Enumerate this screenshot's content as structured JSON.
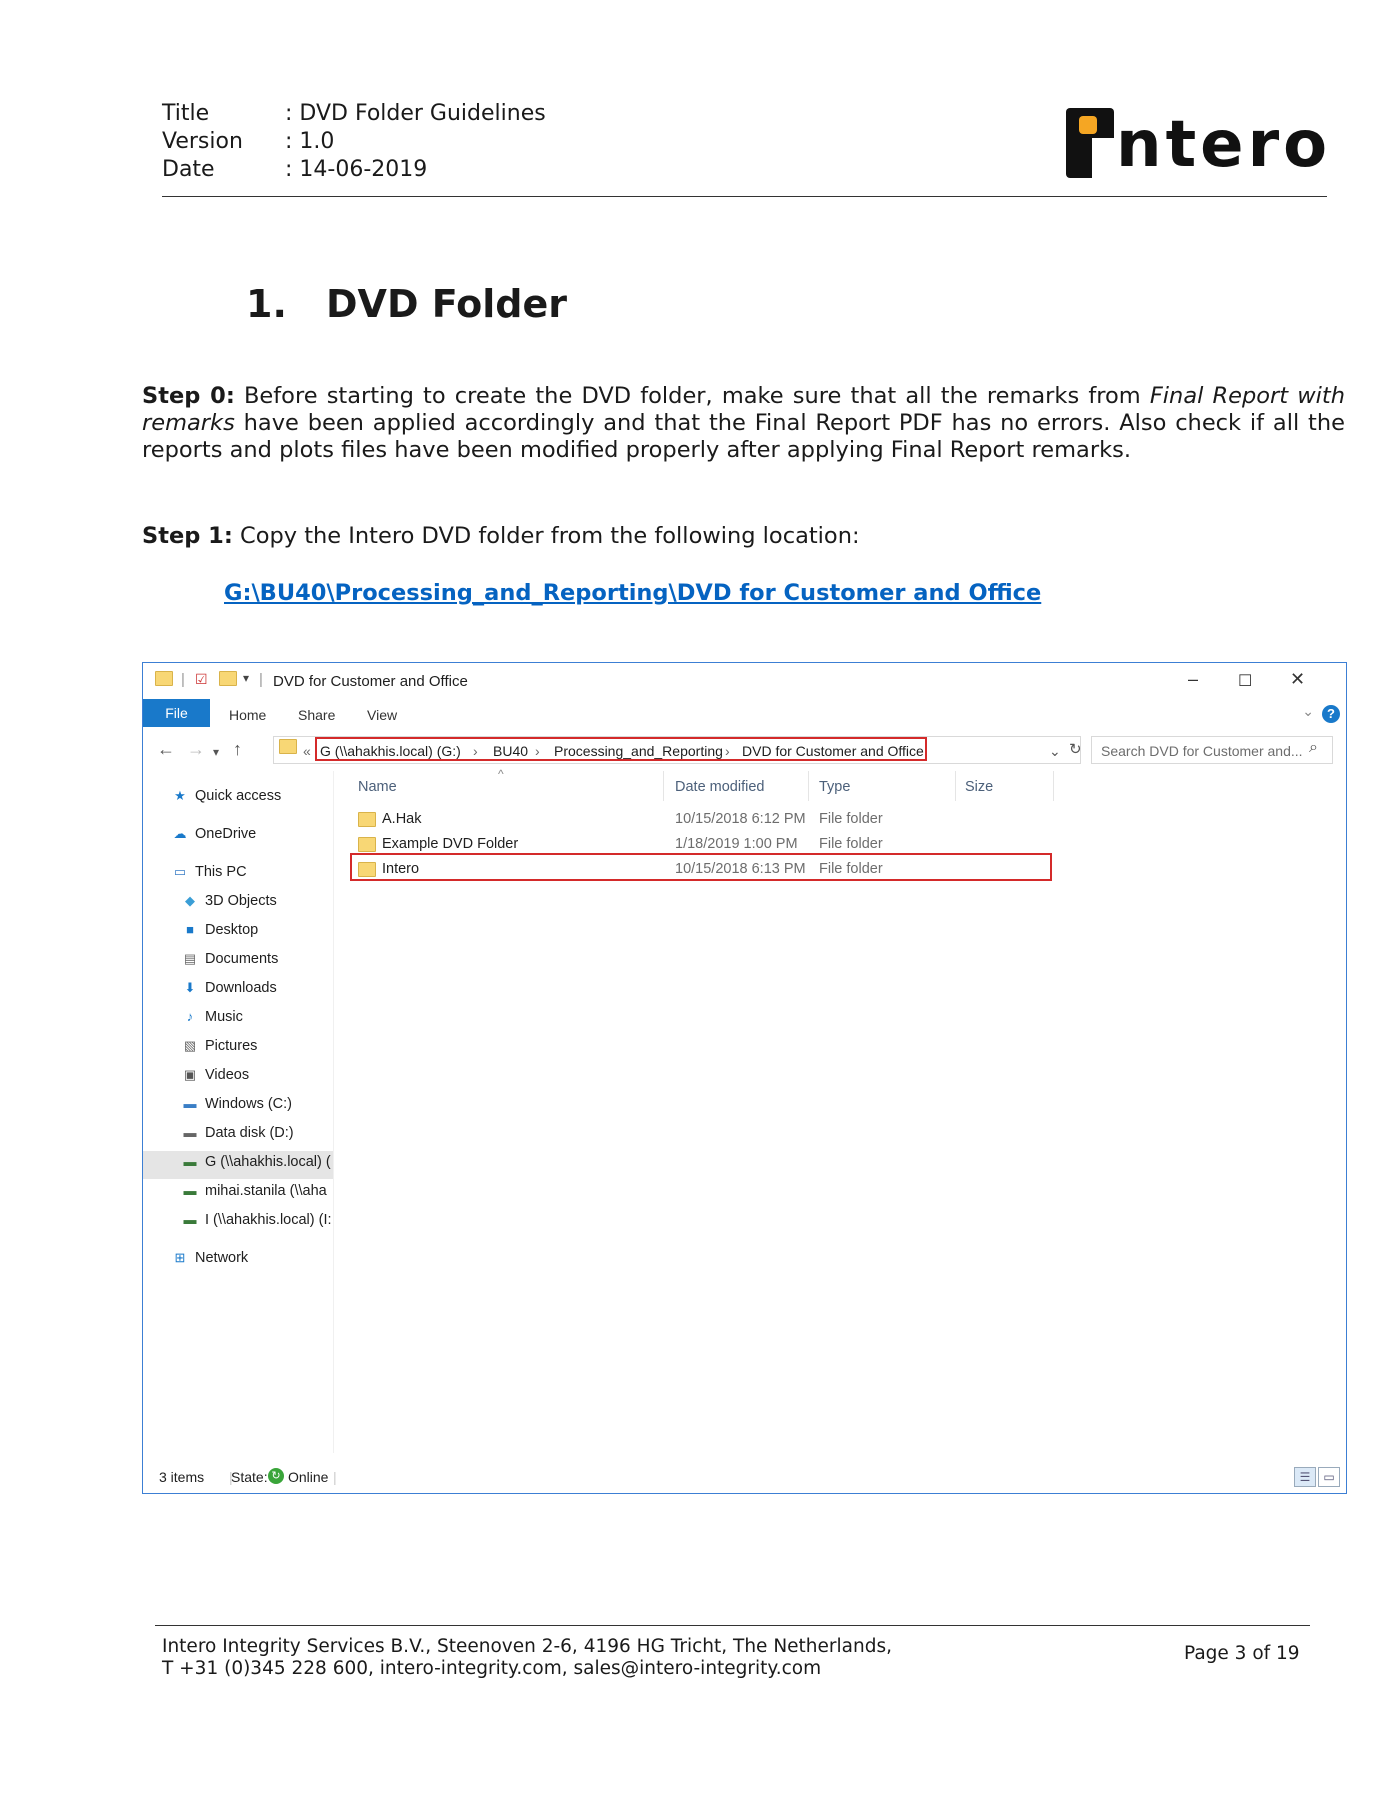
{
  "header": {
    "title_key": "Title",
    "title_value": ": DVD Folder Guidelines",
    "version_key": "Version",
    "version_value": ": 1.0",
    "date_key": "Date",
    "date_value": ": 14-06-2019",
    "logo_text": "ntero"
  },
  "section": {
    "number": "1.",
    "title": "DVD Folder"
  },
  "step0": {
    "label": "Step 0:",
    "text_a": " Before starting to create the DVD folder, make sure that all the remarks from ",
    "italic": "Final Report with remarks",
    "text_b": " have been applied accordingly and that the Final Report PDF has no errors. Also check if all the reports and plots files have been modified properly after applying Final Report remarks."
  },
  "step1": {
    "label": "Step 1:",
    "text": " Copy the Intero DVD folder from the following location:",
    "link": "G:\\BU40\\Processing_and_Reporting\\DVD for Customer and Office"
  },
  "explorer": {
    "window_title": "DVD for Customer and Office",
    "ribbon": {
      "file": "File",
      "home": "Home",
      "share": "Share",
      "view": "View"
    },
    "breadcrumb": [
      "G (\\\\ahakhis.local) (G:)",
      "BU40",
      "Processing_and_Reporting",
      "DVD for Customer and Office"
    ],
    "search_placeholder": "Search DVD for Customer and...",
    "sidebar": {
      "quick_access": "Quick access",
      "onedrive": "OneDrive",
      "this_pc": "This PC",
      "objects3d": "3D Objects",
      "desktop": "Desktop",
      "documents": "Documents",
      "downloads": "Downloads",
      "music": "Music",
      "pictures": "Pictures",
      "videos": "Videos",
      "windows_c": "Windows (C:)",
      "data_d": "Data disk (D:)",
      "g_drive": "G (\\\\ahakhis.local) (",
      "mihai": "mihai.stanila (\\\\aha",
      "i_drive": "I (\\\\ahakhis.local) (I:",
      "network": "Network"
    },
    "columns": {
      "name": "Name",
      "date": "Date modified",
      "type": "Type",
      "size": "Size"
    },
    "rows": [
      {
        "name": "A.Hak",
        "date": "10/15/2018 6:12 PM",
        "type": "File folder"
      },
      {
        "name": "Example DVD Folder",
        "date": "1/18/2019 1:00 PM",
        "type": "File folder"
      },
      {
        "name": "Intero",
        "date": "10/15/2018 6:13 PM",
        "type": "File folder"
      }
    ],
    "status": {
      "items": "3 items",
      "state_label": "State:",
      "state_value": "Online"
    },
    "colors": {
      "accent": "#1979ca",
      "highlight": "#d42a2a",
      "folder": "#f8d775"
    },
    "icons": [
      "back-arrow-icon",
      "forward-arrow-icon",
      "up-arrow-icon",
      "refresh-icon",
      "search-icon",
      "help-icon",
      "folder-icon"
    ]
  },
  "footer": {
    "line1": "Intero Integrity Services B.V., Steenoven 2-6, 4196 HG Tricht, The Netherlands,",
    "line2": "T +31 (0)345 228 600, intero-integrity.com, sales@intero-integrity.com",
    "page": "Page 3 of 19"
  }
}
